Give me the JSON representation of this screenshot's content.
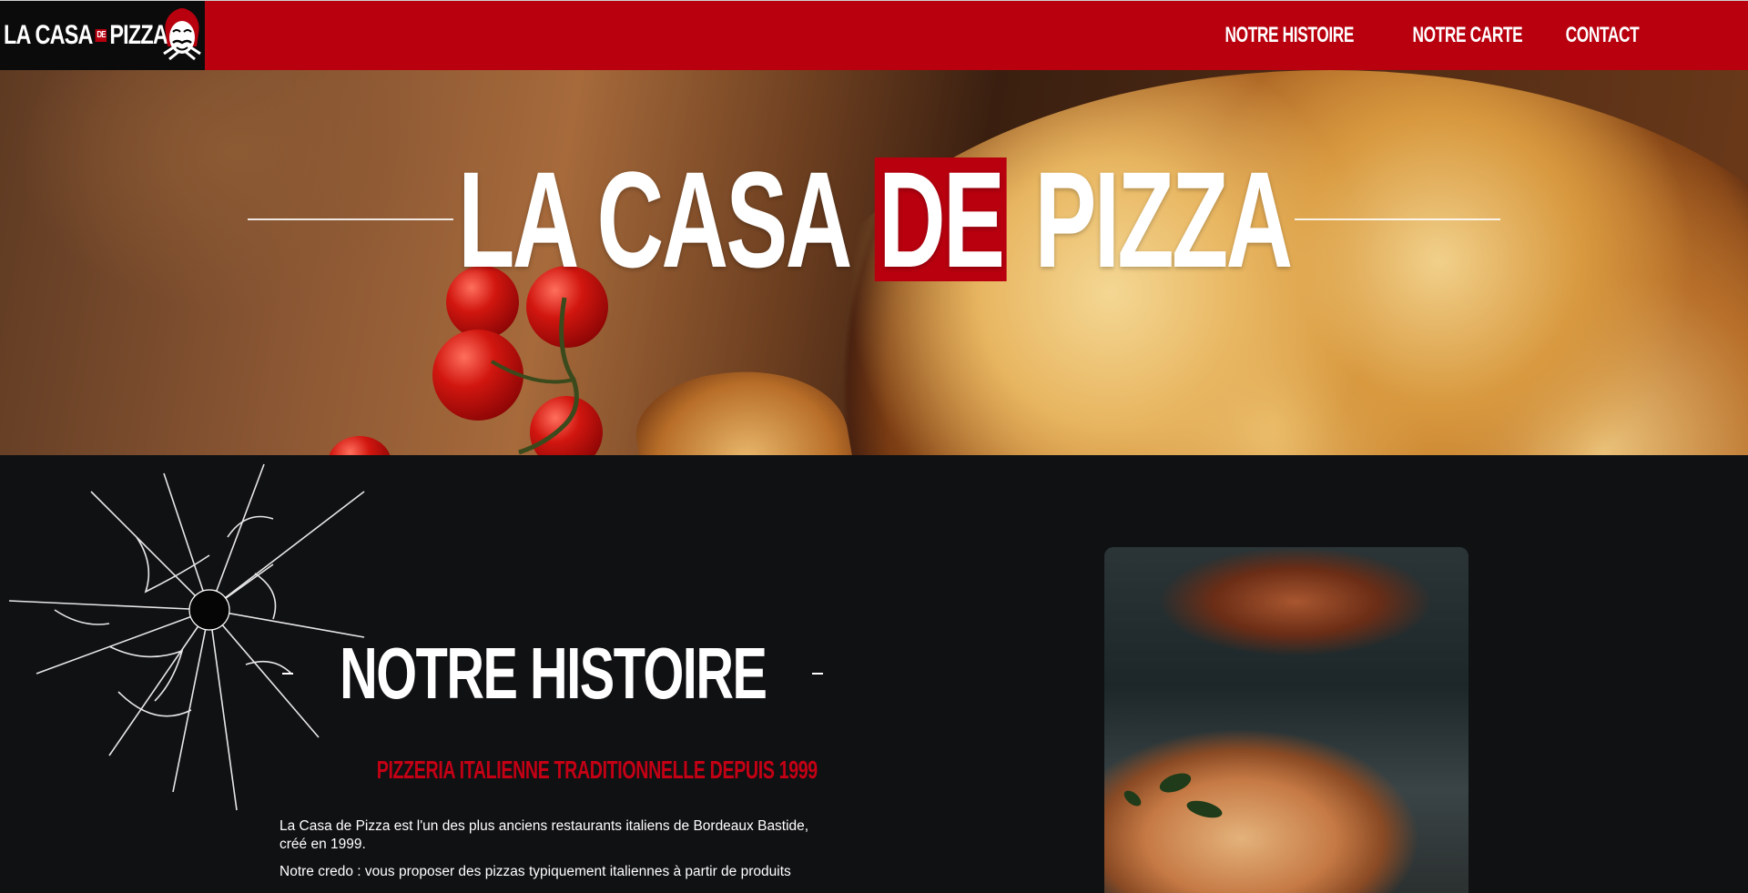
{
  "navbar": {
    "logo": {
      "part1": "LA CASA",
      "de": "DE",
      "part2": "PIZZA",
      "mask_icon": "dali-mask-icon"
    },
    "links": [
      {
        "label": "NOTRE HISTOIRE"
      },
      {
        "label": "NOTRE CARTE"
      },
      {
        "label": "CONTACT"
      }
    ]
  },
  "hero": {
    "title_part1": "LA CASA",
    "title_de": "DE",
    "title_part2": "PIZZA"
  },
  "story": {
    "title": "NOTRE HISTOIRE",
    "subtitle": "PIZZERIA ITALIENNE TRADITIONNELLE DEPUIS 1999",
    "paragraph1": "La Casa de Pizza est l'un des plus anciens restaurants italiens de Bordeaux Bastide, créé en 1999.",
    "paragraph2": "Notre credo : vous proposer des pizzas typiquement italiennes à partir de produits"
  },
  "colors": {
    "brand_red": "#b8000f",
    "subtitle_red": "#c40015",
    "background_dark": "#101113"
  }
}
